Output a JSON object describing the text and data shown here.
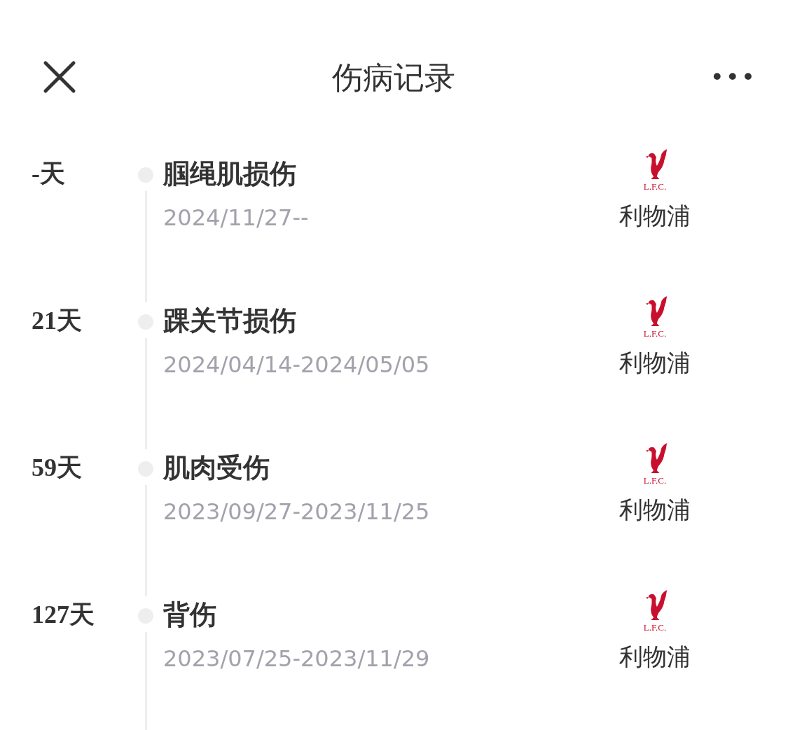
{
  "header": {
    "title": "伤病记录",
    "more": "•••"
  },
  "records": [
    {
      "duration": "-天",
      "injury": "腘绳肌损伤",
      "dates": "2024/11/27--",
      "crest_text": "L.F.C.",
      "club": "利物浦"
    },
    {
      "duration": "21天",
      "injury": "踝关节损伤",
      "dates": "2024/04/14-2024/05/05",
      "crest_text": "L.F.C.",
      "club": "利物浦"
    },
    {
      "duration": "59天",
      "injury": "肌肉受伤",
      "dates": "2023/09/27-2023/11/25",
      "crest_text": "L.F.C.",
      "club": "利物浦"
    },
    {
      "duration": "127天",
      "injury": "背伤",
      "dates": "2023/07/25-2023/11/29",
      "crest_text": "L.F.C.",
      "club": "利物浦"
    }
  ]
}
